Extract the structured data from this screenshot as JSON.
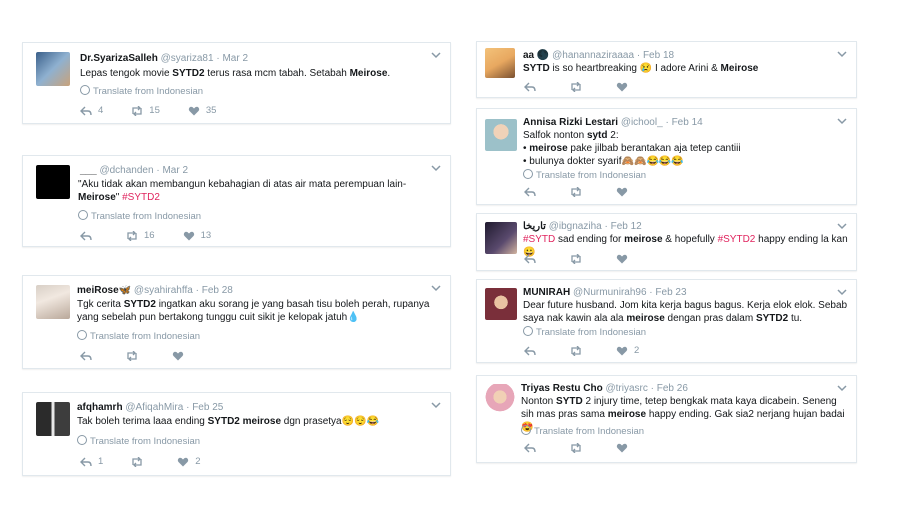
{
  "left": [
    {
      "name": "Dr.SyarizaSalleh",
      "handle": "@syariza81",
      "date": "Mar 2",
      "text_html": "Lepas tengok movie <b>SYTD2</b> terus rasa mcm tabah. Setabah <b>Meirose</b>.",
      "translate": "Translate from Indonesian",
      "reply": "4",
      "retweet": "15",
      "like": "35"
    },
    {
      "name": "___",
      "handle": "@dchanden",
      "date": "Mar 2",
      "text_html": "\"Aku tidak akan membangun kebahagian di atas air mata perempuan lain-<br><b>Meirose</b>\" <span class='tag'>#SYTD2</span>",
      "translate": "Translate from Indonesian",
      "reply": "",
      "retweet": "16",
      "like": "13"
    },
    {
      "name": "meiRose🦋",
      "handle": "@syahirahffa",
      "date": "Feb 28",
      "text_html": "Tgk cerita <b>SYTD2</b> ingatkan aku sorang je yang basah tisu boleh perah, rupanya yang sebelah pun bertakong tunggu cuit sikit je kelopak jatuh💧",
      "translate": "Translate from Indonesian",
      "reply": "",
      "retweet": "",
      "like": ""
    },
    {
      "name": "afqhamrh",
      "handle": "@AfiqahMira",
      "date": "Feb 25",
      "text_html": "Tak boleh terima laaa ending <b>SYTD2 meirose</b> dgn prasetya😌😌😂",
      "translate": "Translate from Indonesian",
      "reply": "1",
      "retweet": "",
      "like": "2"
    }
  ],
  "right": [
    {
      "name": "aa 🌑",
      "handle": "@hanannaziraaaa",
      "date": "Feb 18",
      "text_html": "<b>SYTD</b> is so heartbreaking 😢 I adore Arini &amp; <b>Meirose</b>",
      "translate": "",
      "reply": "",
      "retweet": "",
      "like": ""
    },
    {
      "name": "Annisa Rizki Lestari",
      "handle": "@ichool_",
      "date": "Feb 14",
      "text_html": "Salfok nonton <b>sytd</b> 2:<br>• <b>meirose</b> pake jilbab berantakan aja tetep cantiii<br>• bulunya dokter syarif🙈🙈😂😂😂",
      "translate": "Translate from Indonesian",
      "reply": "",
      "retweet": "",
      "like": ""
    },
    {
      "name": "تاريخا",
      "handle": "@ibgnaziha",
      "date": "Feb 12",
      "text_html": "<span class='tag'>#SYTD</span> sad ending for <b>meirose</b> &amp; hopefully <span class='tag'>#SYTD2</span> happy ending la kan 😀",
      "translate": "",
      "reply": "",
      "retweet": "",
      "like": ""
    },
    {
      "name": "MUNIRAH",
      "handle": "@Nurmunirah96",
      "date": "Feb 23",
      "text_html": "Dear future husband. Jom kita kerja bagus bagus. Kerja elok elok. Sebab saya nak kawin ala ala <b>meirose</b> dengan pras dalam <b>SYTD2</b> tu.",
      "translate": "Translate from Indonesian",
      "reply": "",
      "retweet": "",
      "like": "2"
    },
    {
      "name": "Triyas Restu Cho",
      "handle": "@triyasrc",
      "date": "Feb 26",
      "text_html": "Nonton <b>SYTD</b> 2 injury time, tetep bengkak mata kaya dicabein. Seneng sih mas pras sama <b>meirose</b> happy ending. Gak sia2 nerjang hujan badai 😍",
      "translate": "Translate from Indonesian",
      "reply": "",
      "retweet": "",
      "like": ""
    }
  ]
}
